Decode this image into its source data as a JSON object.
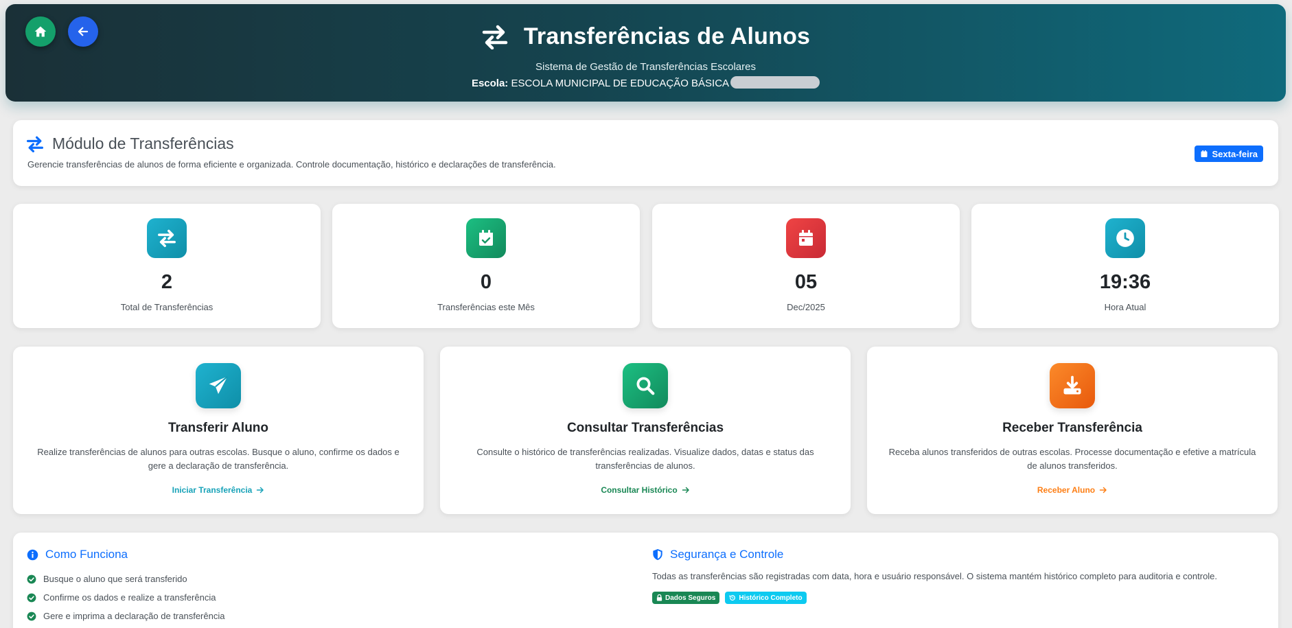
{
  "header": {
    "title": "Transferências de Alunos",
    "subtitle": "Sistema de Gestão de Transferências Escolares",
    "school_label": "Escola:",
    "school_name": "ESCOLA MUNICIPAL DE EDUCAÇÃO BÁSICA"
  },
  "module": {
    "title": "Módulo de Transferências",
    "description": "Gerencie transferências de alunos de forma eficiente e organizada. Controle documentação, histórico e declarações de transferência.",
    "day_badge": "Sexta-feira"
  },
  "stats": [
    {
      "value": "2",
      "label": "Total de Transferências",
      "icon": "transfer-icon",
      "color": "#17a2b8"
    },
    {
      "value": "0",
      "label": "Transferências este Mês",
      "icon": "calendar-check-icon",
      "color": "#198754"
    },
    {
      "value": "05",
      "label": "Dec/2025",
      "icon": "calendar-icon",
      "color": "#dc3545"
    },
    {
      "value": "19:36",
      "label": "Hora Atual",
      "icon": "clock-icon",
      "color": "#17a2b8"
    }
  ],
  "actions": [
    {
      "title": "Transferir Aluno",
      "description": "Realize transferências de alunos para outras escolas. Busque o aluno, confirme os dados e gere a declaração de transferência.",
      "link": "Iniciar Transferência",
      "icon": "paper-plane-icon",
      "color": "#17a2b8"
    },
    {
      "title": "Consultar Transferências",
      "description": "Consulte o histórico de transferências realizadas. Visualize dados, datas e status das transferências de alunos.",
      "link": "Consultar Histórico",
      "icon": "search-icon",
      "color": "#198754"
    },
    {
      "title": "Receber Transferência",
      "description": "Receba alunos transferidos de outras escolas. Processe documentação e efetive a matrícula de alunos transferidos.",
      "link": "Receber Aluno",
      "icon": "download-icon",
      "color": "#fd7e14"
    }
  ],
  "how_it_works": {
    "title": "Como Funciona",
    "steps": [
      "Busque o aluno que será transferido",
      "Confirme os dados e realize a transferência",
      "Gere e imprima a declaração de transferência"
    ]
  },
  "security": {
    "title": "Segurança e Controle",
    "text": "Todas as transferências são registradas com data, hora e usuário responsável. O sistema mantém histórico completo para auditoria e controle.",
    "badges": [
      "Dados Seguros",
      "Histórico Completo"
    ]
  }
}
